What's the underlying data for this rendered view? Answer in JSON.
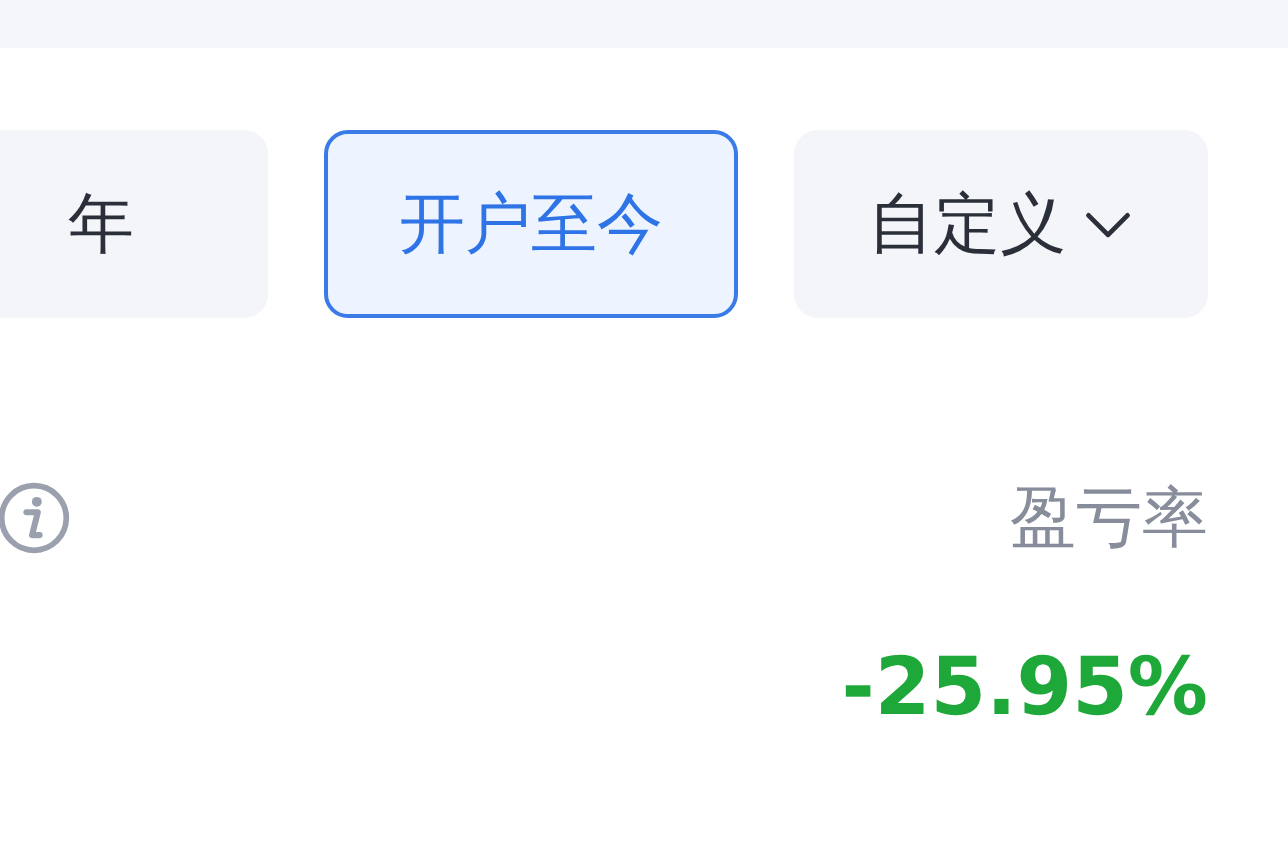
{
  "tabs": [
    {
      "label": "年",
      "selected": false,
      "dropdown": false
    },
    {
      "label": "开户至今",
      "selected": true,
      "dropdown": false
    },
    {
      "label": "自定义",
      "selected": false,
      "dropdown": true
    }
  ],
  "summary": {
    "label": "盈亏率",
    "value": "-25.95%"
  }
}
